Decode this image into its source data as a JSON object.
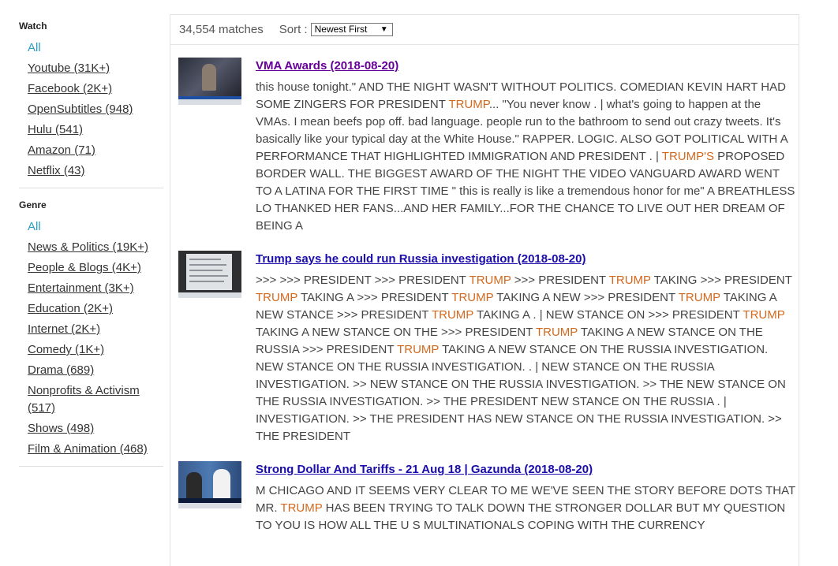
{
  "sidebar": {
    "watch": {
      "heading": "Watch",
      "items": [
        {
          "label": "All"
        },
        {
          "label": "Youtube (31K+)"
        },
        {
          "label": "Facebook (2K+)"
        },
        {
          "label": "OpenSubtitles (948)"
        },
        {
          "label": "Hulu (541)"
        },
        {
          "label": "Amazon (71)"
        },
        {
          "label": "Netflix (43)"
        }
      ]
    },
    "genre": {
      "heading": "Genre",
      "items": [
        {
          "label": "All"
        },
        {
          "label": "News & Politics (19K+)"
        },
        {
          "label": "People & Blogs (4K+)"
        },
        {
          "label": "Entertainment (3K+)"
        },
        {
          "label": "Education (2K+)"
        },
        {
          "label": "Internet (2K+)"
        },
        {
          "label": "Comedy (1K+)"
        },
        {
          "label": "Drama (689)"
        },
        {
          "label": "Nonprofits & Activism (517)"
        },
        {
          "label": "Shows (498)"
        },
        {
          "label": "Film & Animation (468)"
        }
      ]
    }
  },
  "toolbar": {
    "matches": "34,554 matches",
    "sort_label": "Sort :",
    "sort_value": "Newest First",
    "caret": "▼"
  },
  "colors": {
    "highlight": "#d2691e",
    "link": "#1a0dab",
    "visited": "#660099",
    "active": "#2a9fbf"
  },
  "results": [
    {
      "title": "VMA Awards (2018-08-20)",
      "visited": true,
      "thumb": "vma-awards-thumbnail",
      "snippet": [
        {
          "t": "this house tonight.\" AND THE NIGHT WASN'T WITHOUT POLITICS. COMEDIAN KEVIN HART HAD SOME ZINGERS FOR PRESIDENT "
        },
        {
          "t": "TRUMP",
          "hl": true
        },
        {
          "t": "... \"You never know . | what's going to happen at the VMAs. I mean beefs pop off. bad language. people run to the bathroom to send out crazy tweets. It's basically like your typical day at the White House.\" RAPPER. LOGIC. ALSO GOT POLITICAL WITH A PERFORMANCE THAT HIGHLIGHTED IMMIGRATION AND PRESIDENT . | "
        },
        {
          "t": "TRUMP'S",
          "hl": true
        },
        {
          "t": " PROPOSED BORDER WALL. THE BIGGEST AWARD OF THE NIGHT THE VIDEO VANGUARD AWARD WENT TO A LATINA FOR THE FIRST TIME \" this is really is like a tremendous honor for me\" A BREATHLESS LO THANKED HER FANS...AND HER FAMILY...FOR THE CHANCE TO LIVE OUT HER DREAM OF BEING A"
        }
      ]
    },
    {
      "title": "Trump says he could run Russia investigation (2018-08-20)",
      "visited": false,
      "thumb": "trump-tweet-thumbnail",
      "snippet": [
        {
          "t": ">>> >>> PRESIDENT >>> PRESIDENT "
        },
        {
          "t": "TRUMP",
          "hl": true
        },
        {
          "t": " >>> PRESIDENT "
        },
        {
          "t": "TRUMP",
          "hl": true
        },
        {
          "t": " TAKING >>> PRESIDENT "
        },
        {
          "t": "TRUMP",
          "hl": true
        },
        {
          "t": " TAKING A >>> PRESIDENT "
        },
        {
          "t": "TRUMP",
          "hl": true
        },
        {
          "t": " TAKING A NEW >>> PRESIDENT "
        },
        {
          "t": "TRUMP",
          "hl": true
        },
        {
          "t": " TAKING A NEW STANCE >>> PRESIDENT "
        },
        {
          "t": "TRUMP",
          "hl": true
        },
        {
          "t": " TAKING A . | NEW STANCE ON >>> PRESIDENT "
        },
        {
          "t": "TRUMP",
          "hl": true
        },
        {
          "t": " TAKING A NEW STANCE ON THE >>> PRESIDENT "
        },
        {
          "t": "TRUMP",
          "hl": true
        },
        {
          "t": " TAKING A NEW STANCE ON THE RUSSIA >>> PRESIDENT "
        },
        {
          "t": "TRUMP",
          "hl": true
        },
        {
          "t": " TAKING A NEW STANCE ON THE RUSSIA INVESTIGATION. NEW STANCE ON THE RUSSIA INVESTIGATION. . | NEW STANCE ON THE RUSSIA INVESTIGATION. >> NEW STANCE ON THE RUSSIA INVESTIGATION. >> THE NEW STANCE ON THE RUSSIA INVESTIGATION. >> THE PRESIDENT NEW STANCE ON THE RUSSIA . | INVESTIGATION. >> THE PRESIDENT HAS NEW STANCE ON THE RUSSIA INVESTIGATION. >> THE PRESIDENT"
        }
      ]
    },
    {
      "title": "Strong Dollar And Tariffs - 21 Aug 18 | Gazunda (2018-08-20)",
      "visited": false,
      "thumb": "news-panel-thumbnail",
      "snippet": [
        {
          "t": "M CHICAGO AND IT SEEMS VERY CLEAR TO ME WE'VE SEEN THE STORY BEFORE DOTS THAT MR. "
        },
        {
          "t": "TRUMP",
          "hl": true
        },
        {
          "t": " HAS BEEN TRYING TO TALK DOWN THE STRONGER DOLLAR BUT MY QUESTION TO YOU IS HOW ALL THE U S MULTINATIONALS COPING WITH THE CURRENCY"
        }
      ]
    }
  ]
}
